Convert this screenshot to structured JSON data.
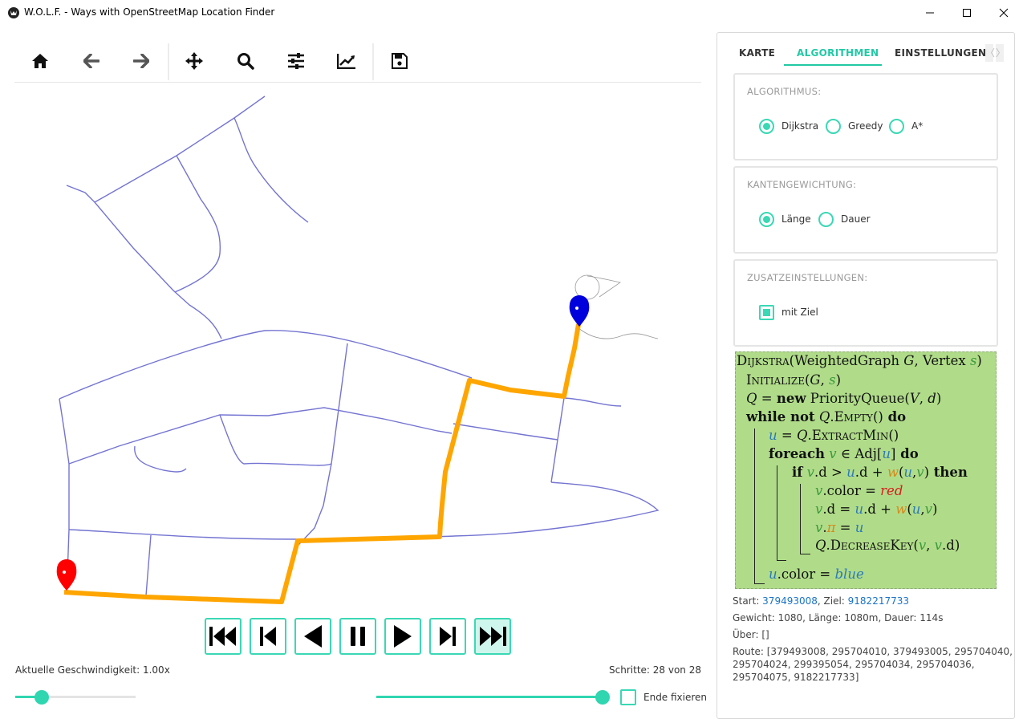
{
  "window": {
    "title": "W.O.L.F. - Ways with OpenStreetMap Location Finder",
    "icon": "wolf-logo-icon",
    "controls": [
      "minimize-icon",
      "maximize-icon",
      "close-icon"
    ]
  },
  "toolbar": {
    "buttons": [
      "home-icon",
      "back-arrow-icon",
      "forward-arrow-icon",
      "pan-move-icon",
      "zoom-search-icon",
      "configure-sliders-icon",
      "chart-line-icon",
      "save-floppy-icon"
    ]
  },
  "map": {
    "road_color": "#7474d2",
    "route_color": "#ffa500",
    "start_marker_color": "#ff0000",
    "goal_marker_color": "#0000dd"
  },
  "playback": {
    "buttons": [
      "skip-to-start-icon",
      "step-back-icon",
      "play-backward-icon",
      "pause-icon",
      "play-forward-icon",
      "step-forward-icon",
      "skip-to-end-icon"
    ],
    "speed_label": "Aktuelle Geschwindigkeit: 1.00x",
    "steps_label": "Schritte: 28 von 28",
    "speed_slider_fraction": 0.22,
    "steps_slider_fraction": 1.0,
    "fix_end_label": "Ende fixieren",
    "fix_end_checked": false,
    "accent_color": "#2fd6b0"
  },
  "tabs": {
    "items": [
      "KARTE",
      "ALGORITHMEN",
      "EINSTELLUNGEN"
    ],
    "active": "ALGORITHMEN",
    "scroll_left": "〈",
    "scroll_right": "〉"
  },
  "algorithm": {
    "title": "ALGORITHMUS:",
    "options": [
      "Dijkstra",
      "Greedy",
      "A*"
    ],
    "selected": "Dijkstra"
  },
  "weighting": {
    "title": "KANTENGEWICHTUNG:",
    "options": [
      "Länge",
      "Dauer"
    ],
    "selected": "Länge"
  },
  "extra": {
    "title": "ZUSATZEINSTELLUNGEN:",
    "option": "mit Ziel",
    "checked": true
  },
  "pseudocode": {
    "background": "#b0dc89",
    "l1": {
      "name": "Dijkstra",
      "args": "(WeightedGraph ",
      "g": "G",
      "sep": ", Vertex ",
      "s": "s",
      "close": ")"
    },
    "l2": {
      "name": "Initialize",
      "open": "(",
      "g": "G",
      "sep": ", ",
      "s": "s",
      "close": ")"
    },
    "l3": {
      "q": "Q",
      "eq": " = ",
      "kw": "new",
      "rest": " PriorityQueue(",
      "v": "V",
      "sep": ", ",
      "d": "d",
      "close": ")"
    },
    "l4": {
      "kw1": "while not",
      "q": " Q",
      "dot": ".",
      "m": "Empty",
      "paren": "()",
      "kw2": " do"
    },
    "l5": {
      "u": "u",
      "eq": " = ",
      "q": "Q",
      "dot": ".",
      "m": "ExtractMin",
      "paren": "()"
    },
    "l6": {
      "kw1": "foreach",
      "v": " v",
      "in": " ∈ Adj[",
      "u": "u",
      "close": "]",
      "kw2": " do"
    },
    "l7": {
      "kw1": "if",
      "v1": " v",
      "d1": ".d > ",
      "u1": "u",
      "d2": ".d + ",
      "w": "w",
      "o": "(",
      "u2": "u",
      "c": ",",
      "v2": "v",
      "cl": ")",
      "kw2": " then"
    },
    "l8": {
      "v": "v",
      "attr": ".color = ",
      "val": "red"
    },
    "l9": {
      "v": "v",
      "d1": ".d = ",
      "u1": "u",
      "d2": ".d + ",
      "w": "w",
      "o": "(",
      "u2": "u",
      "c": ",",
      "v2": "v",
      "cl": ")"
    },
    "l10": {
      "v": "v",
      "dot": ".",
      "pi": "π",
      "eq": " = ",
      "u": "u"
    },
    "l11": {
      "q": "Q",
      "dot": ".",
      "m": "DecreaseKey",
      "o": "(",
      "v1": "v",
      "c": ",",
      "v2": " v",
      "d": ".d",
      "cl": ")"
    },
    "l12": {
      "u": "u",
      "attr": ".color = ",
      "val": "blue"
    }
  },
  "info": {
    "start_label": "Start: ",
    "start_id": "379493008",
    "goal_label": ", Ziel: ",
    "goal_id": "9182217733",
    "weight_line": "Gewicht: 1080, Länge: 1080m, Dauer: 114s",
    "via_line": "Über: []",
    "route_line1": "Route: [379493008, 295704010, 379493005, 295704040,",
    "route_line2": "295704024, 299395054, 295704034, 295704036,",
    "route_line3": "295704075, 9182217733]"
  }
}
